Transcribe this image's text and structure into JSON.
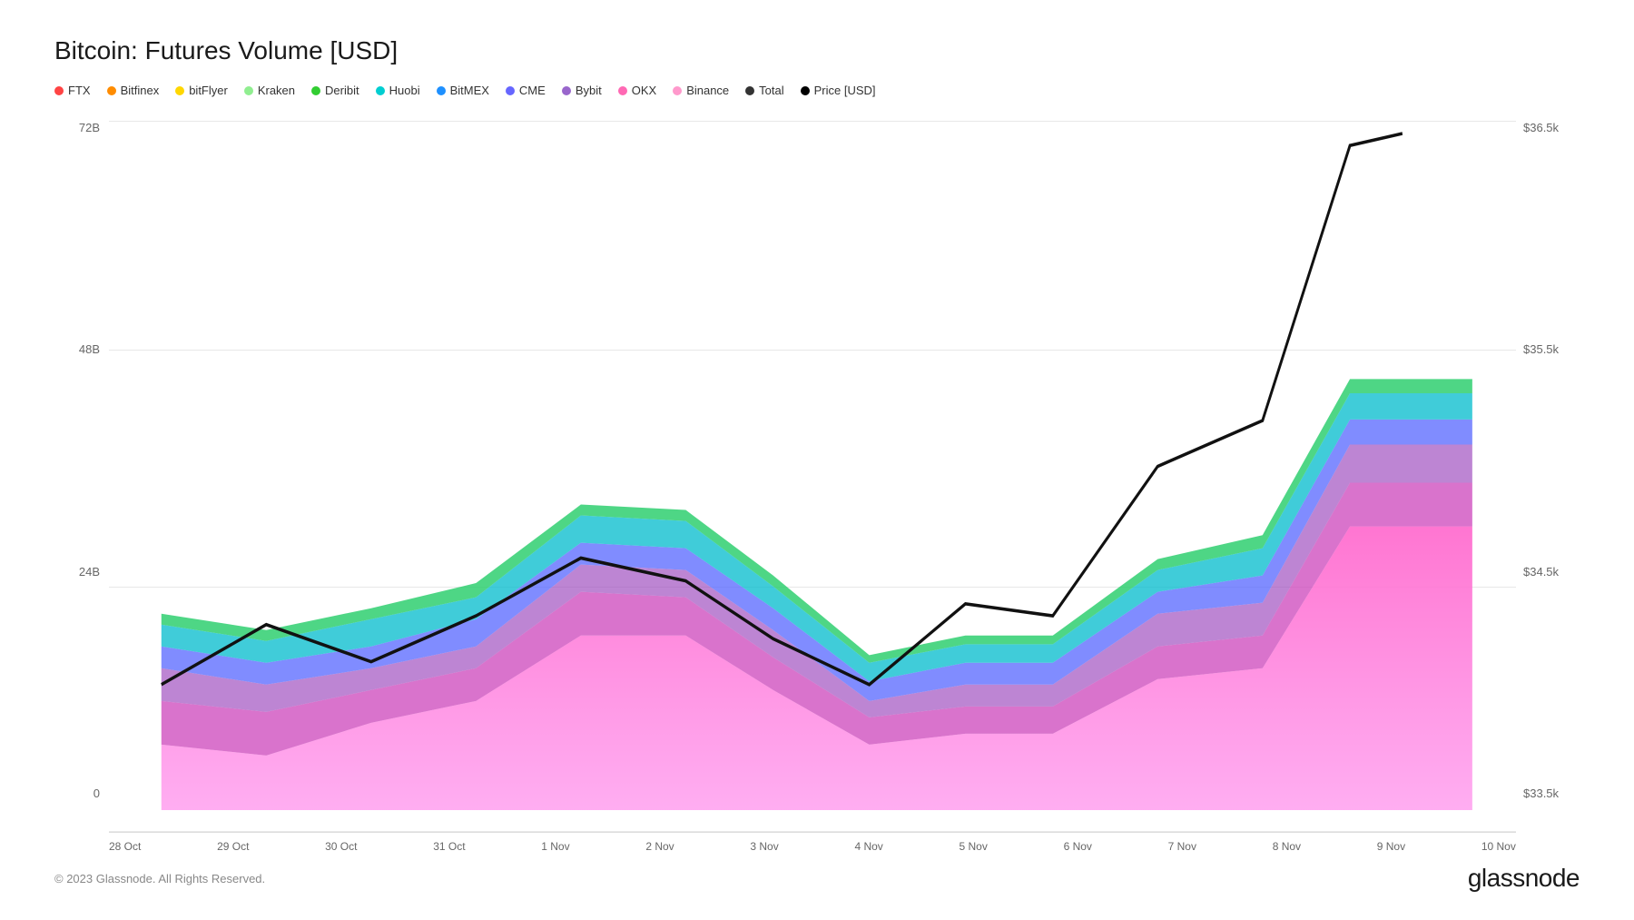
{
  "title": "Bitcoin: Futures Volume [USD]",
  "legend": [
    {
      "label": "FTX",
      "color": "#ff4444"
    },
    {
      "label": "Bitfinex",
      "color": "#ff8c00"
    },
    {
      "label": "bitFlyer",
      "color": "#ffd700"
    },
    {
      "label": "Kraken",
      "color": "#90ee90"
    },
    {
      "label": "Deribit",
      "color": "#32cd32"
    },
    {
      "label": "Huobi",
      "color": "#00ced1"
    },
    {
      "label": "BitMEX",
      "color": "#1e90ff"
    },
    {
      "label": "CME",
      "color": "#6666ff"
    },
    {
      "label": "Bybit",
      "color": "#9966cc"
    },
    {
      "label": "OKX",
      "color": "#ff69b4"
    },
    {
      "label": "Binance",
      "color": "#ff99cc"
    },
    {
      "label": "Total",
      "color": "#333333"
    },
    {
      "label": "Price [USD]",
      "color": "#000000"
    }
  ],
  "yAxis": {
    "left": [
      "72B",
      "48B",
      "24B",
      "0"
    ],
    "right": [
      "$36.5k",
      "$35.5k",
      "$34.5k",
      "$33.5k"
    ]
  },
  "xAxis": [
    "28 Oct",
    "29 Oct",
    "30 Oct",
    "31 Oct",
    "1 Nov",
    "2 Nov",
    "3 Nov",
    "4 Nov",
    "5 Nov",
    "6 Nov",
    "7 Nov",
    "8 Nov",
    "9 Nov",
    "10 Nov"
  ],
  "footer": {
    "copyright": "© 2023 Glassnode. All Rights Reserved.",
    "brand": "glassnode"
  }
}
